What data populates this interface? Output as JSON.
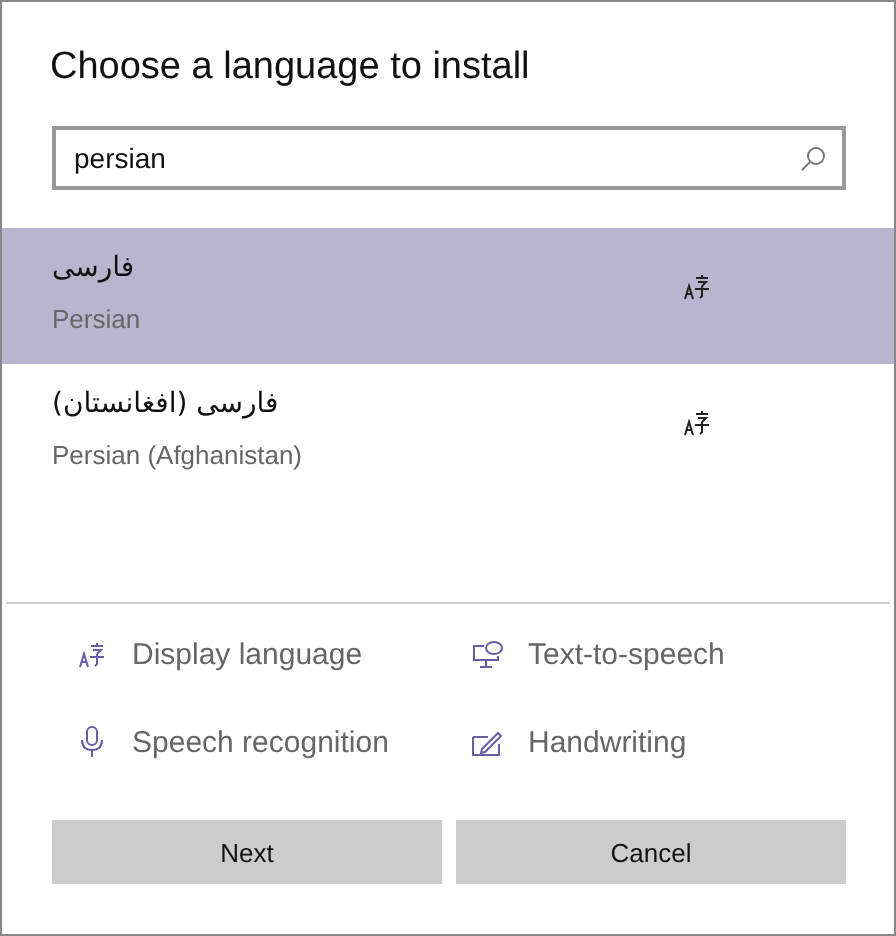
{
  "dialog": {
    "title": "Choose a language to install"
  },
  "search": {
    "value": "persian"
  },
  "languages": [
    {
      "native": "فارسی",
      "name": "Persian",
      "selected": true
    },
    {
      "native": "فارسی (افغانستان)",
      "name": "Persian (Afghanistan)",
      "selected": false
    }
  ],
  "features": [
    {
      "kind": "display",
      "label": "Display language"
    },
    {
      "kind": "tts",
      "label": "Text-to-speech"
    },
    {
      "kind": "speech",
      "label": "Speech recognition"
    },
    {
      "kind": "handwriting",
      "label": "Handwriting"
    }
  ],
  "buttons": [
    "Next",
    "Cancel"
  ]
}
